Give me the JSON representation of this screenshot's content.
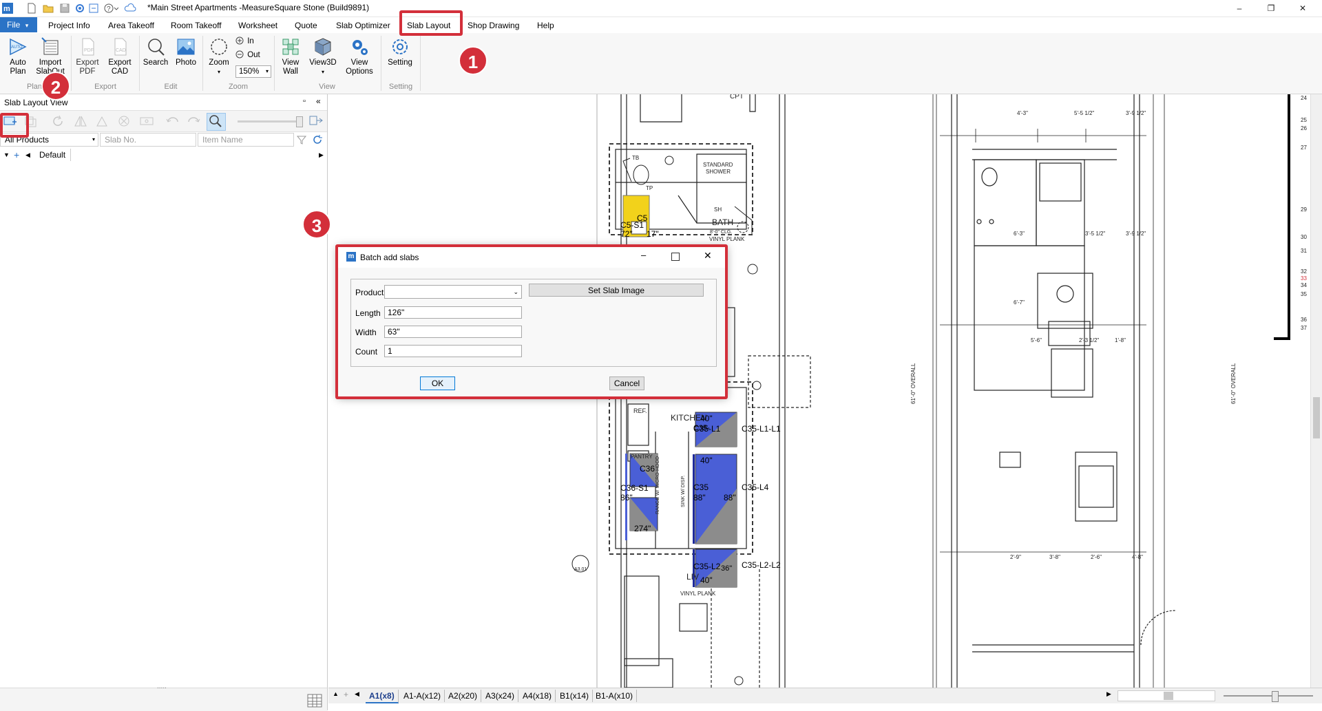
{
  "window": {
    "title": "*Main Street Apartments -MeasureSquare Stone (Build9891)",
    "min": "–",
    "max": "❐",
    "close": "✕"
  },
  "menu": {
    "file": "File",
    "file_arrow": "▾",
    "tabs": [
      "Project Info",
      "Area Takeoff",
      "Room Takeoff",
      "Worksheet",
      "Quote",
      "Slab Optimizer",
      "Slab Layout",
      "Shop Drawing",
      "Help"
    ]
  },
  "ribbon": {
    "auto_plan": "Auto\nPlan",
    "import_slabout": "Import\nSlabOut",
    "export_pdf": "Export\nPDF",
    "export_cad": "Export\nCAD",
    "search": "Search",
    "photo": "Photo",
    "zoom": "Zoom",
    "zoom_in": "In",
    "zoom_out": "Out",
    "zoom_level": "150%",
    "view_wall": "View\nWall",
    "view3d": "View3D",
    "view_options": "View\nOptions",
    "setting": "Setting",
    "groups": [
      "Plan",
      "Export",
      "Edit",
      "Zoom",
      "View",
      "Setting"
    ]
  },
  "panel": {
    "title": "Slab Layout View",
    "filter_product": "All Products",
    "filter_slab_placeholder": "Slab No.",
    "filter_item_placeholder": "Item Name",
    "tree_default": "Default",
    "bottom_grip": "....."
  },
  "dialog": {
    "title": "Batch add slabs",
    "product_label": "Product",
    "product_value": "",
    "set_image": "Set Slab Image",
    "length_label": "Length",
    "length_value": "126\"",
    "width_label": "Width",
    "width_value": "63\"",
    "count_label": "Count",
    "count_value": "1",
    "ok": "OK",
    "cancel": "Cancel"
  },
  "callouts": [
    "1",
    "2",
    "3"
  ],
  "sheets": [
    {
      "name": "A1",
      "count": "(x8)"
    },
    {
      "name": "A1-A",
      "count": "(x12)"
    },
    {
      "name": "A2",
      "count": "(x20)"
    },
    {
      "name": "A3",
      "count": "(x24)"
    },
    {
      "name": "A4",
      "count": "(x18)"
    },
    {
      "name": "B1",
      "count": "(x14)"
    },
    {
      "name": "B1-A",
      "count": "(x10)"
    }
  ],
  "drawing": {
    "labels": {
      "cpt": "CPT",
      "bath": "BATH",
      "bath_sub1": "8'-0\" CLG.",
      "bath_sub2": "VINYL PLANK",
      "standard_shower1": "STANDARD",
      "standard_shower2": "SHOWER",
      "sh": "SH",
      "tb": "TB",
      "tp": "TP",
      "kitchen": "KITCHEN",
      "ref": "REF.",
      "pantry": "PANTRY",
      "living": "LIV",
      "living_sub": "VINYL PLANK",
      "range": "RANGE W/ MICRO-HOOD",
      "sink": "SINK W/ DISP.",
      "ref_a301": "A3.01",
      "overall_1": "61'-0\" OVERALL",
      "overall_2": "61'-0\" OVERALL"
    },
    "slabs": {
      "c5_s1": "C5-S1",
      "c5": "C5",
      "c5_dim1": "72\"",
      "c5_dim2": "17\"",
      "c35_l1_l1": "C35-L1-L1",
      "c35_l4": "C35-L4",
      "c35_l2_l2": "C35-L2-L2",
      "c36_s1": "C36-S1",
      "c36": "C36",
      "dim_40a": "40\"",
      "dim_40b": "40\"",
      "dim_40c": "40\"",
      "dim_86": "86\"",
      "dim_88a": "88\"",
      "dim_88b": "88\"",
      "dim_274": "274\"",
      "c35_a": "C35-L1",
      "c35_b": "C35",
      "c35_c": "C35-L2",
      "c35_d": "C35-",
      "dim_36": "36\""
    },
    "dims": [
      "4'-3\"",
      "5'-5 1/2\"",
      "3'-9 1/2\"",
      "6'-3\"",
      "3'-5 1/2\"",
      "3'-9 1/2\"",
      "6'-7\"",
      "5'-6\"",
      "2'-3 1/2\"",
      "1'-8\"",
      "2'-9\"",
      "3'-8\"",
      "2'-6\"",
      "4'-8\""
    ],
    "ruler_numbers": [
      "24",
      "25",
      "26",
      "27",
      "29",
      "30",
      "31",
      "32",
      "33",
      "34",
      "35",
      "36",
      "37"
    ]
  },
  "colors": {
    "accent": "#2b73c6",
    "callout": "#d32f3a",
    "slab_blue": "#4a5fd6",
    "slab_yellow": "#f2d21b",
    "slab_gray": "#8c8c8c"
  }
}
